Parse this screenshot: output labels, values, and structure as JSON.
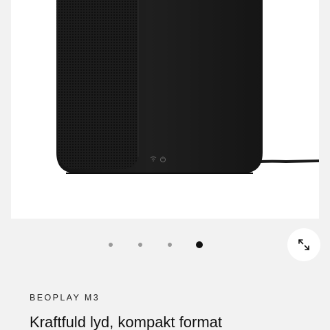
{
  "product": {
    "brand_label": "BEOPLAY M3",
    "title": "Kraftfuld lyd, kompakt format"
  },
  "gallery": {
    "slide_count": 4,
    "active_index": 3,
    "image_icon": "speaker-image",
    "expand_icon": "expand-arrows-icon"
  },
  "colors": {
    "page_background": "#f2f2f2",
    "image_background": "#ffffff",
    "dot_inactive": "#9a9a9a",
    "dot_active": "#111111",
    "speaker_body": "#1b1b1b"
  }
}
